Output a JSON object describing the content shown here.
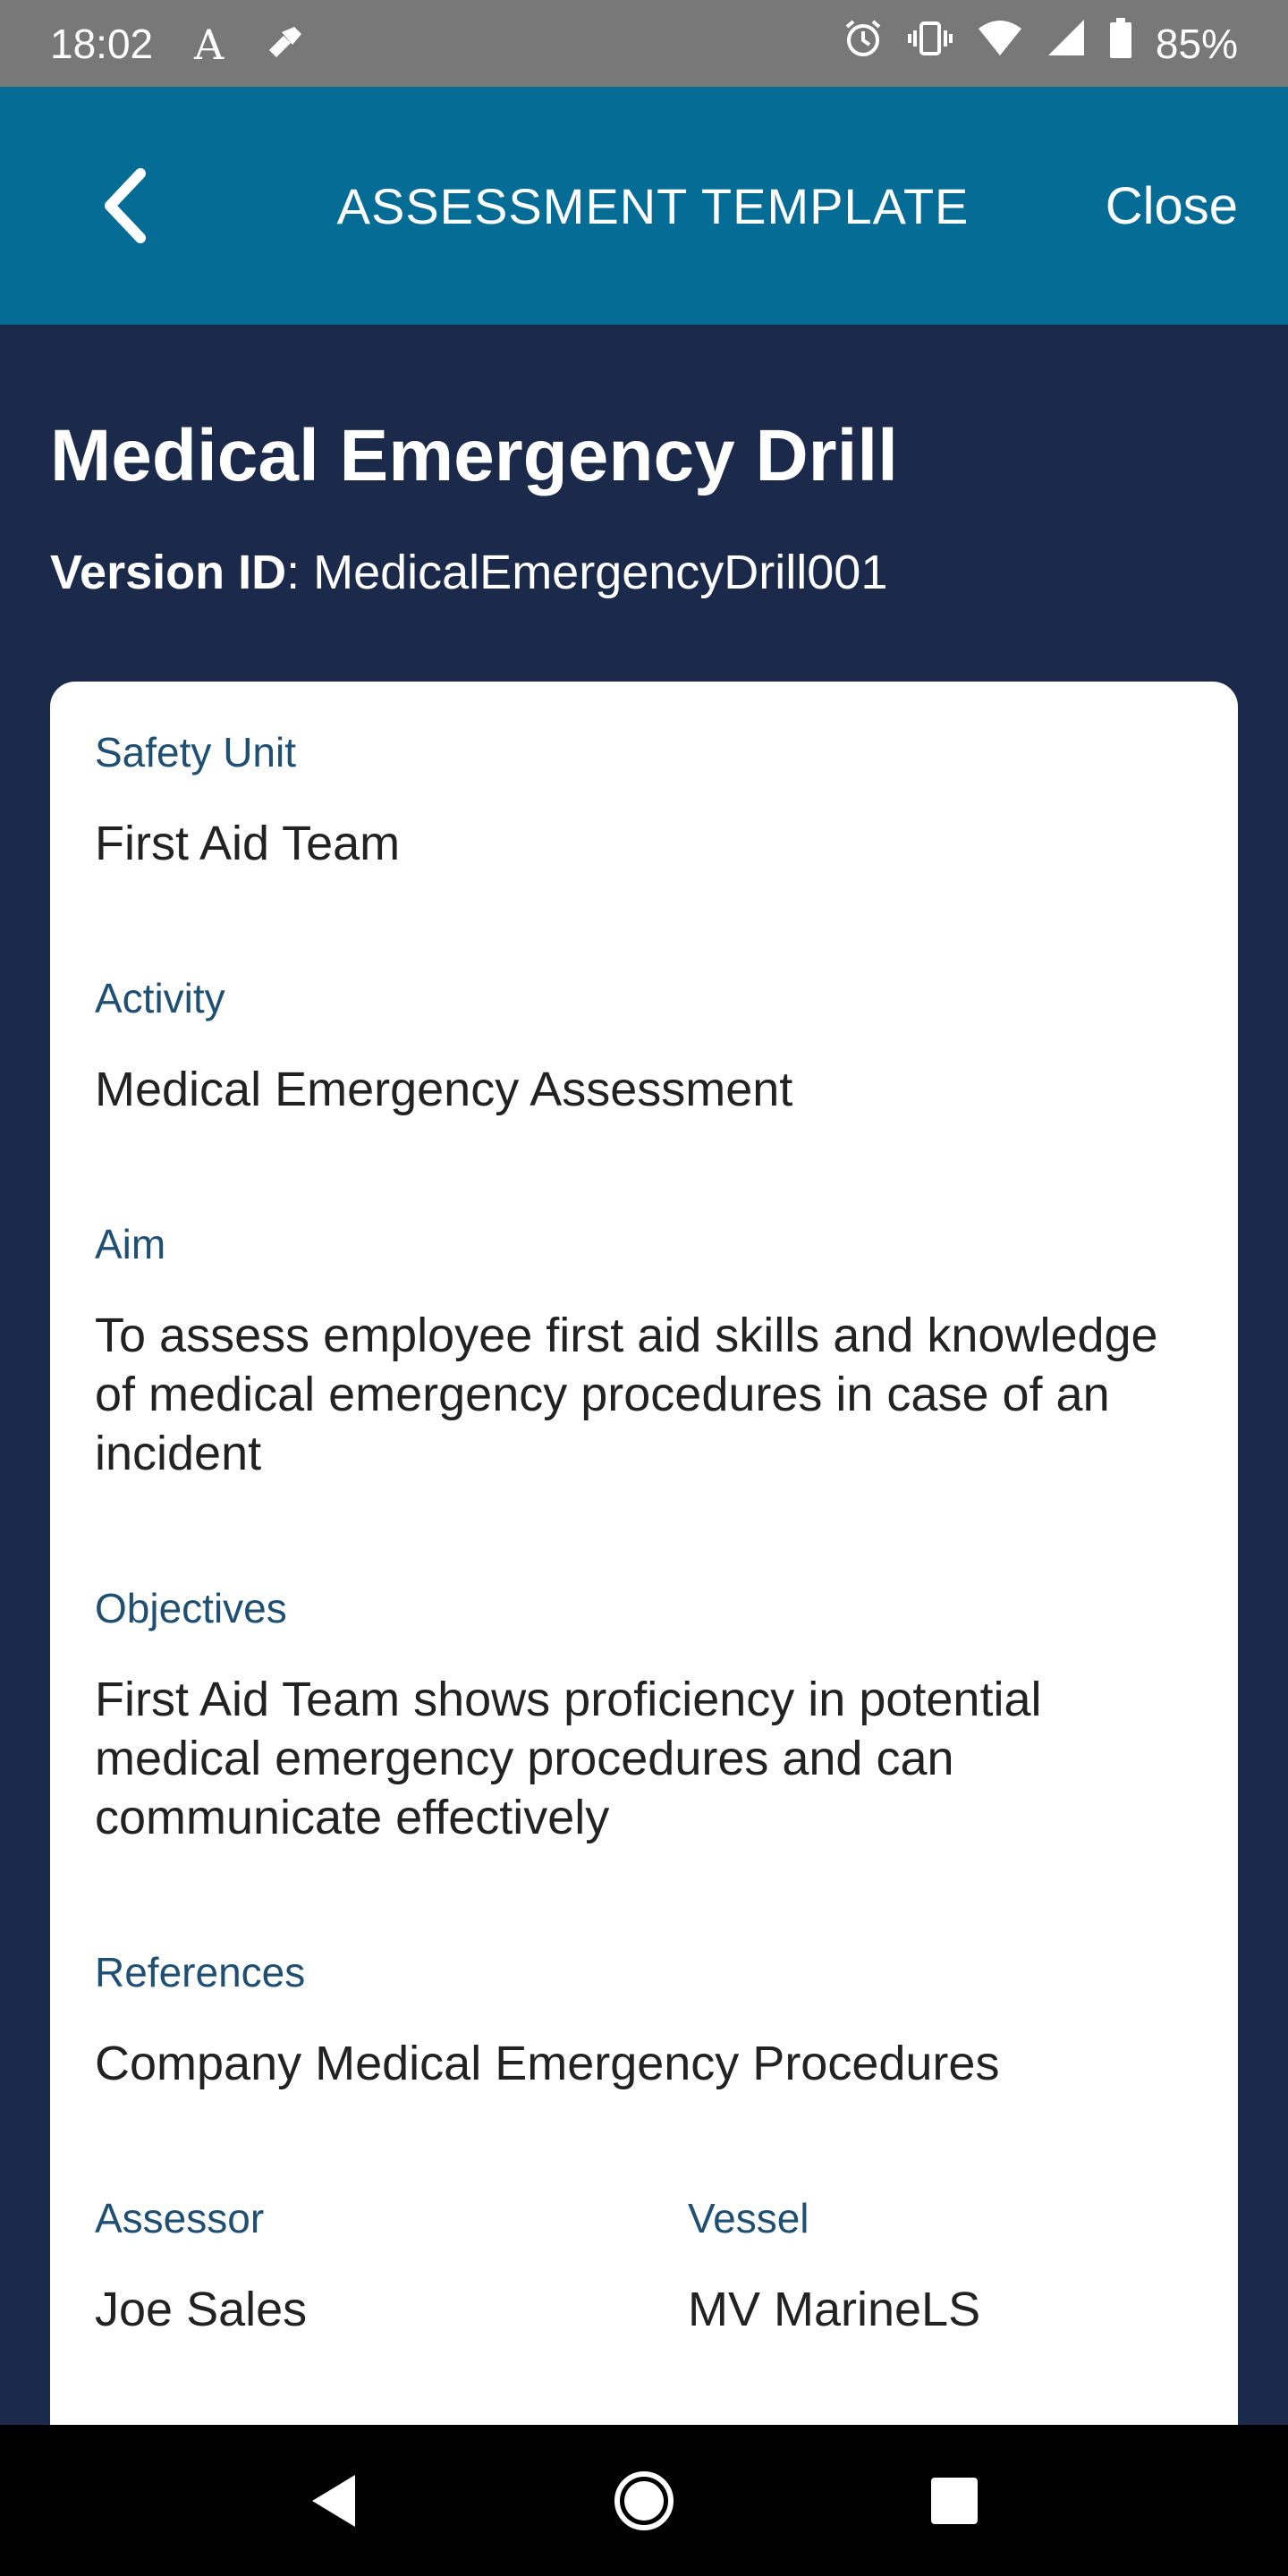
{
  "status_bar": {
    "time": "18:02",
    "battery": "85%",
    "icons": [
      "font-icon",
      "app-notification-icon",
      "alarm-icon",
      "vibrate-icon",
      "wifi-icon",
      "signal-icon",
      "battery-icon"
    ]
  },
  "app_bar": {
    "back_icon": "chevron-left-icon",
    "title": "ASSESSMENT TEMPLATE",
    "close_label": "Close",
    "background": "#056d95"
  },
  "page": {
    "title": "Medical Emergency Drill",
    "version_label": "Version ID",
    "version_separator": ": ",
    "version_value": "MedicalEmergencyDrill001",
    "background": "#1b2a4a"
  },
  "card": {
    "fields": [
      {
        "label": "Safety Unit",
        "value": "First Aid Team"
      },
      {
        "label": "Activity",
        "value": "Medical Emergency Assessment"
      },
      {
        "label": "Aim",
        "value": "To assess employee first aid skills and knowledge of medical emergency procedures in case of an incident"
      },
      {
        "label": "Objectives",
        "value": "First Aid Team shows proficiency in potential medical emergency procedures and can communicate effectively"
      },
      {
        "label": "References",
        "value": "Company Medical Emergency Procedures"
      },
      {
        "label": "Assessor",
        "value": "Joe Sales"
      },
      {
        "label": "Vessel",
        "value": "MV MarineLS"
      }
    ],
    "label_color": "#1f4f73"
  },
  "nav_bar": {
    "icons": [
      "nav-back-icon",
      "nav-home-icon",
      "nav-recents-icon"
    ]
  }
}
